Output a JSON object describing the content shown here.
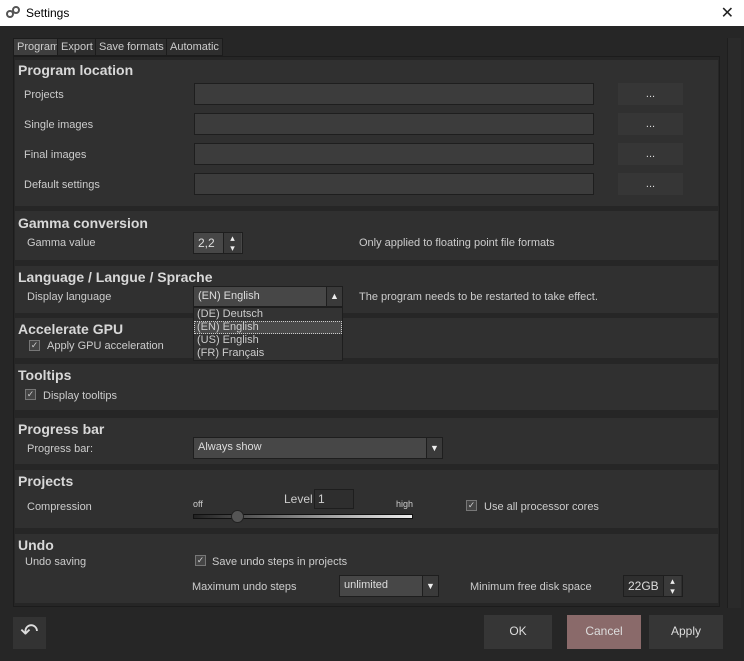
{
  "window": {
    "title": "Settings",
    "close": "✕"
  },
  "tabs": [
    "Program",
    "Export",
    "Save formats",
    "Automatic"
  ],
  "program_location": {
    "title": "Program location",
    "rows": [
      {
        "label": "Projects",
        "value": "",
        "browse": "..."
      },
      {
        "label": "Single images",
        "value": "",
        "browse": "..."
      },
      {
        "label": "Final images",
        "value": "",
        "browse": "..."
      },
      {
        "label": "Default settings",
        "value": "",
        "browse": "..."
      }
    ]
  },
  "gamma": {
    "title": "Gamma conversion",
    "label": "Gamma value",
    "value": "2,2",
    "note": "Only applied to floating point file formats"
  },
  "language": {
    "title": "Language / Langue / Sprache",
    "label": "Display language",
    "selected": "(EN) English",
    "note": "The program needs to be restarted to take effect.",
    "options": [
      "(DE) Deutsch",
      "(EN) English",
      "(US) English",
      "(FR) Français"
    ]
  },
  "gpu": {
    "title": "Accelerate GPU",
    "checkbox": "Apply GPU acceleration",
    "checked": true
  },
  "tooltips": {
    "title": "Tooltips",
    "checkbox": "Display tooltips",
    "checked": true
  },
  "progress": {
    "title": "Progress bar",
    "label": "Progress bar:",
    "selected": "Always show"
  },
  "projects": {
    "title": "Projects",
    "label": "Compression",
    "off": "off",
    "high": "high",
    "level_label": "Level",
    "level": "1",
    "slider_fraction": 0.2,
    "cores": "Use all processor cores",
    "cores_checked": true
  },
  "undo": {
    "title": "Undo",
    "label": "Undo saving",
    "save_steps": "Save undo steps in projects",
    "save_checked": true,
    "max_label": "Maximum undo steps",
    "max_value": "unlimited",
    "disk_label": "Minimum free disk space",
    "disk_value": "22GB"
  },
  "buttons": {
    "ok": "OK",
    "cancel": "Cancel",
    "apply": "Apply"
  },
  "colors": {
    "cancel": "#8a6a6a"
  }
}
